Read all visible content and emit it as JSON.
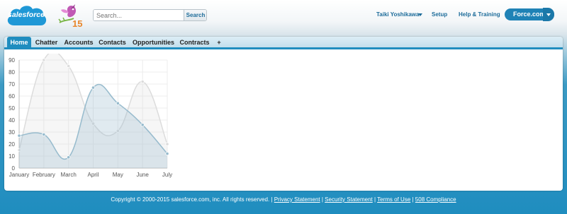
{
  "brand": {
    "logo_text": "salesforce",
    "anniversary": "15"
  },
  "search": {
    "placeholder": "Search...",
    "button_label": "Search"
  },
  "top_nav": {
    "user_name": "Taiki Yoshikawa",
    "setup": "Setup",
    "help": "Help & Training",
    "app_switcher": "Force.com"
  },
  "tabs": [
    {
      "label": "Home",
      "active": true
    },
    {
      "label": "Chatter"
    },
    {
      "label": "Accounts"
    },
    {
      "label": "Contacts"
    },
    {
      "label": "Opportunities"
    },
    {
      "label": "Contracts"
    },
    {
      "label": "+"
    }
  ],
  "colors": {
    "accent": "#1f8dbf",
    "series_a": "#dcdcdc",
    "series_b": "#97bbcd"
  },
  "chart_data": {
    "type": "area",
    "categories": [
      "January",
      "February",
      "March",
      "April",
      "May",
      "June",
      "July"
    ],
    "series": [
      {
        "values": [
          15,
          90,
          85,
          37,
          31,
          72,
          20
        ],
        "color": "#dcdcdc"
      },
      {
        "values": [
          27,
          28,
          9,
          67,
          54,
          36,
          12
        ],
        "color": "#97bbcd"
      }
    ],
    "ylim": [
      0,
      90
    ],
    "yticks": [
      0,
      10,
      20,
      30,
      40,
      50,
      60,
      70,
      80,
      90
    ],
    "grid": true
  },
  "footer": {
    "copyright": "Copyright © 2000-2015 salesforce.com, inc. All rights reserved. |",
    "privacy": "Privacy Statement",
    "security": "Security Statement",
    "terms": "Terms of Use",
    "compliance": "508 Compliance"
  }
}
